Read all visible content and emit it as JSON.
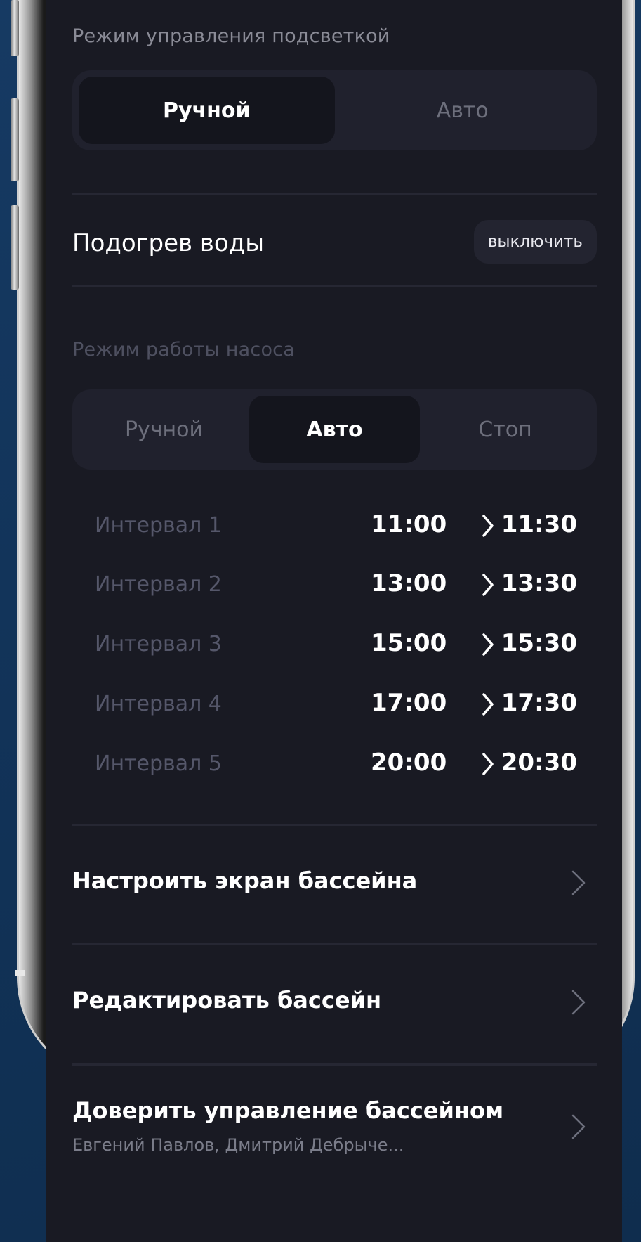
{
  "lighting": {
    "label": "Режим управления подсветкой",
    "options": [
      "Ручной",
      "Авто"
    ],
    "selected": "Ручной"
  },
  "heating": {
    "title": "Подогрев воды",
    "button_label": "выключить"
  },
  "pump": {
    "label": "Режим работы насоса",
    "options": [
      "Ручной",
      "Авто",
      "Стоп"
    ],
    "selected": "Авто",
    "intervals": [
      {
        "label": "Интервал 1",
        "start": "11:00",
        "end": "11:30"
      },
      {
        "label": "Интервал 2",
        "start": "13:00",
        "end": "13:30"
      },
      {
        "label": "Интервал 3",
        "start": "15:00",
        "end": "15:30"
      },
      {
        "label": "Интервал 4",
        "start": "17:00",
        "end": "17:30"
      },
      {
        "label": "Интервал 5",
        "start": "20:00",
        "end": "20:30"
      }
    ]
  },
  "menu": {
    "configure_screen": "Настроить экран бассейна",
    "edit_pool": "Редактировать бассейн",
    "delegate_title": "Доверить управление бассейном",
    "delegate_subtitle": "Евгений Павлов, Дмитрий Дебрыче..."
  },
  "icons": {
    "interval_arrow": "chevron-right-icon",
    "row_chevron": "chevron-right-icon"
  },
  "colors": {
    "screen_bg": "#191a23",
    "segment_bg": "#20212d",
    "segment_active": "#14151d",
    "text_primary": "#ffffff",
    "text_muted": "#8a8b96",
    "backdrop": "#163a63"
  }
}
